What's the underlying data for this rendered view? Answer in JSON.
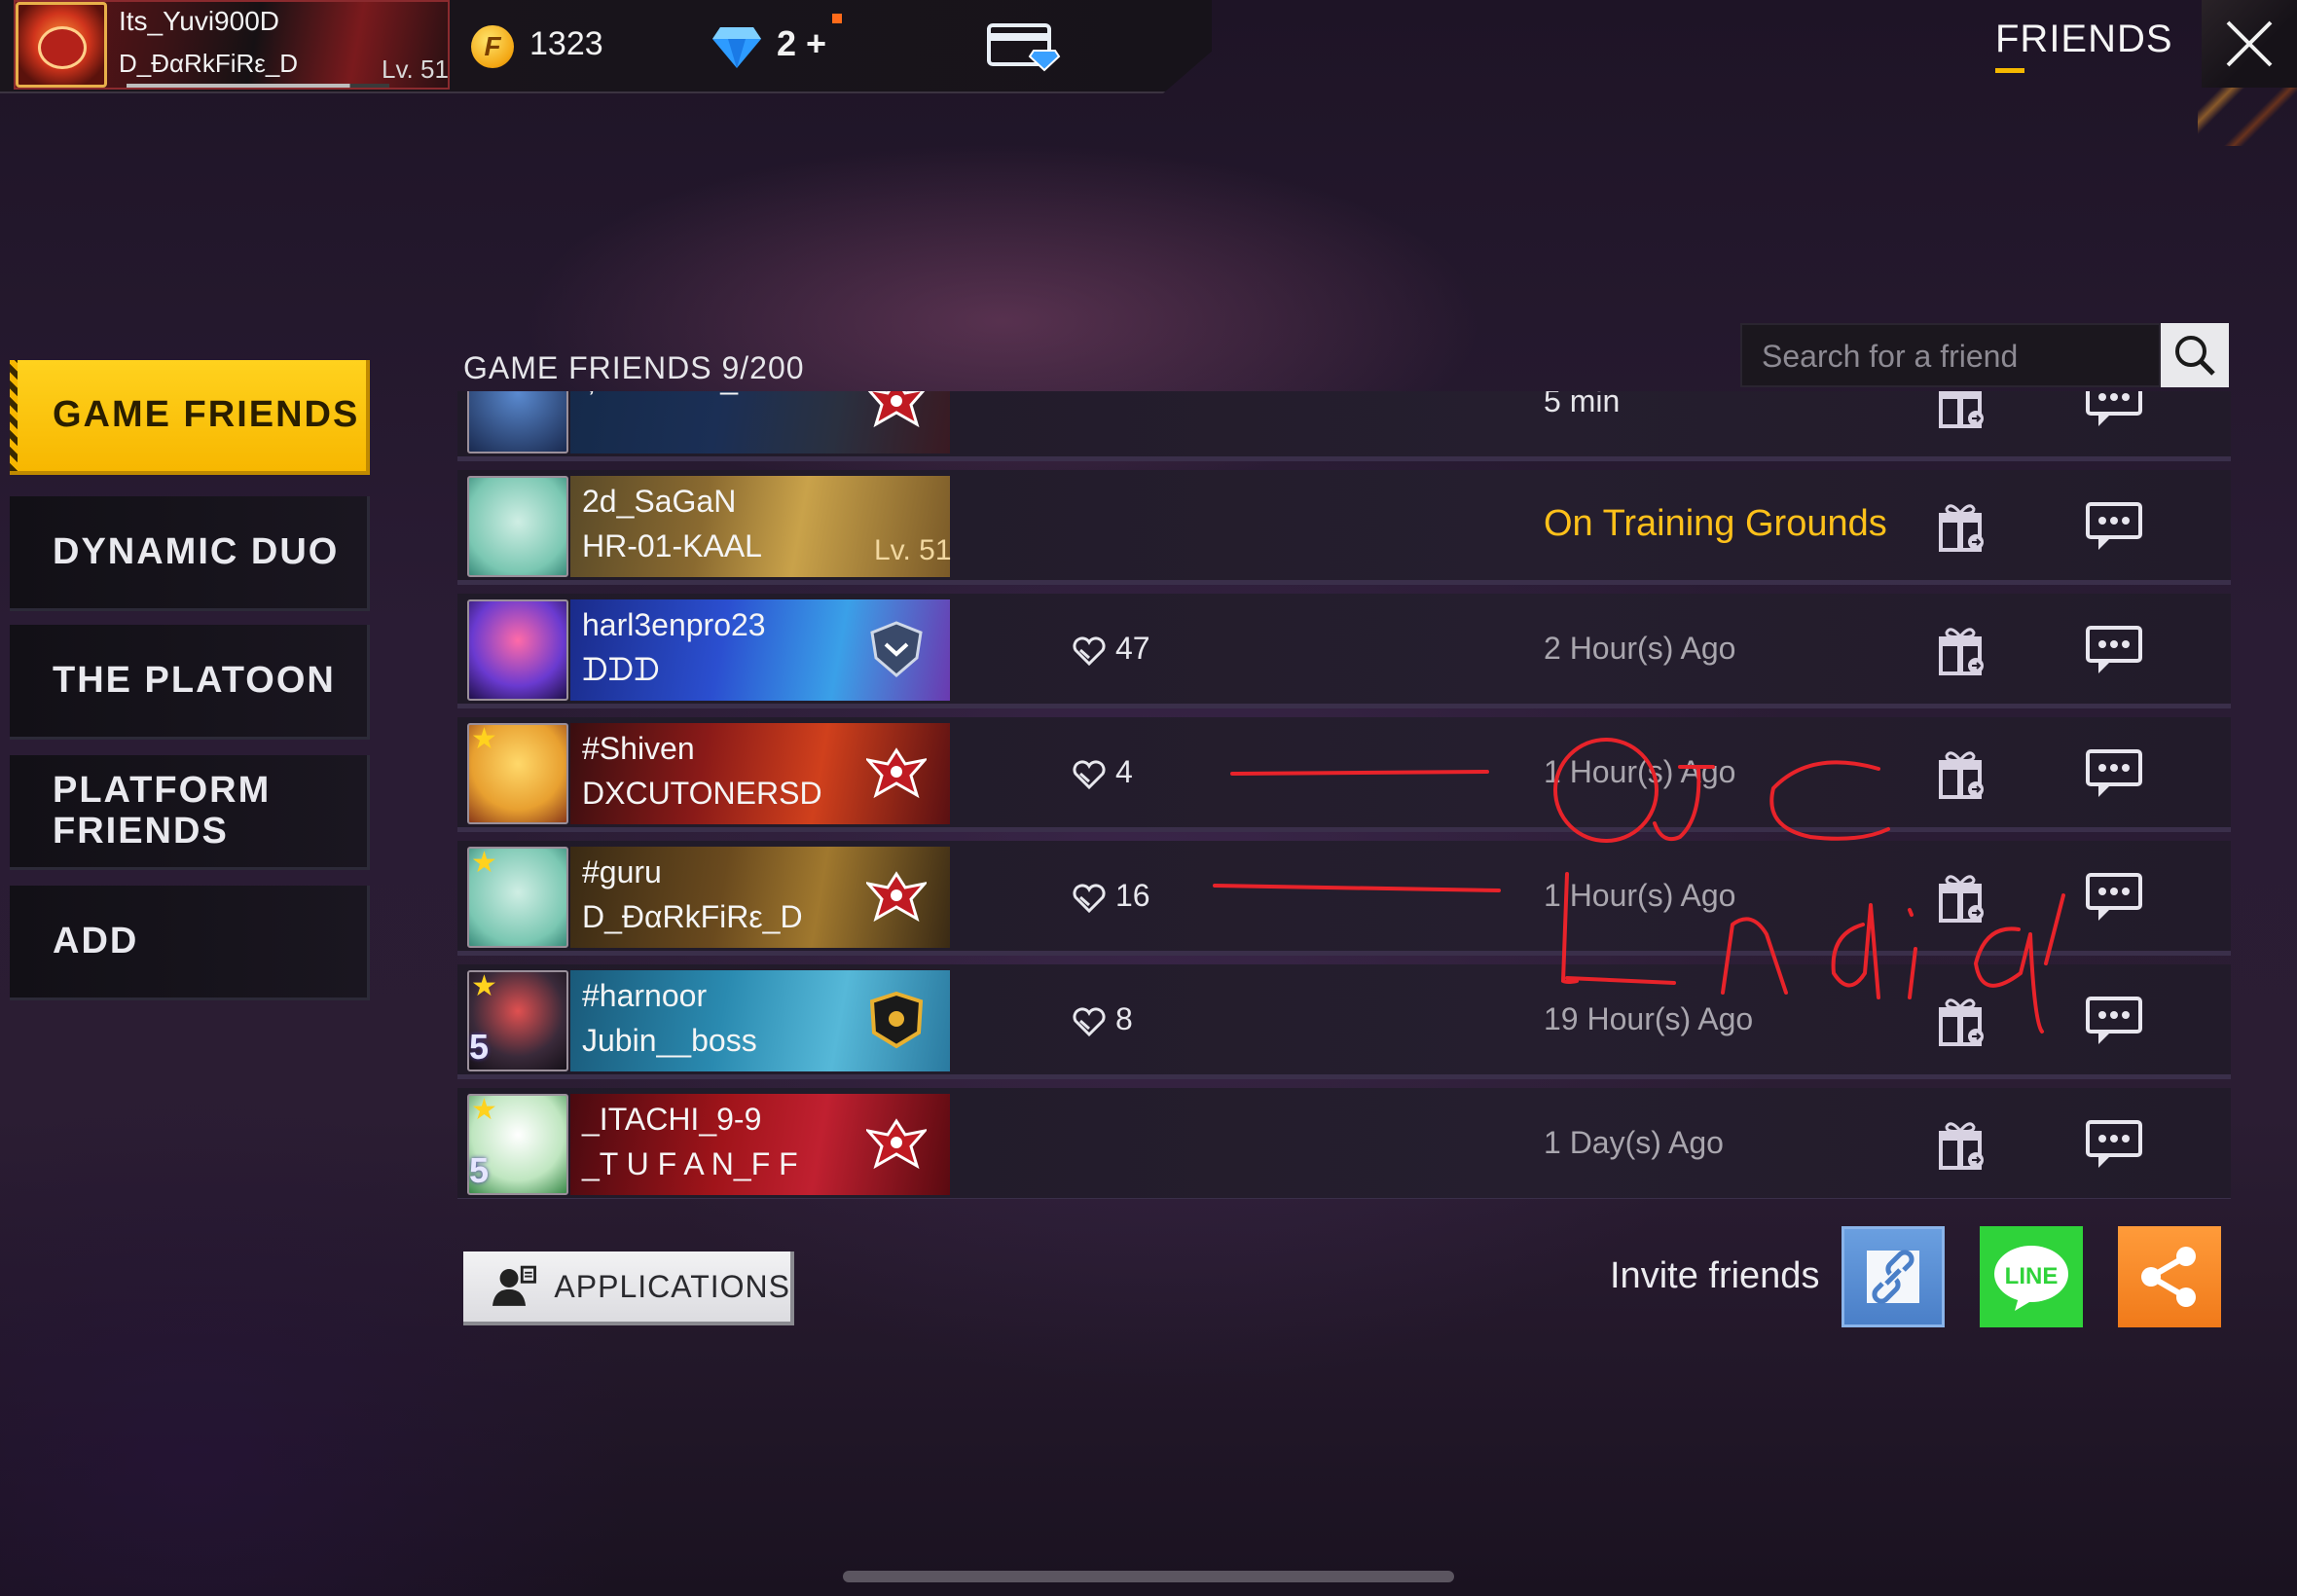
{
  "header": {
    "username": "Its_Yuvi900D",
    "guild": "D_ĐαRkFiRε_D",
    "level": "Lv. 51",
    "level_progress": 0.85,
    "coins": "1323",
    "diamonds": "2",
    "diamonds_plus": "+",
    "title": "FRIENDS"
  },
  "menu": [
    {
      "label": "GAME FRIENDS",
      "active": true
    },
    {
      "label": "DYNAMIC DUO",
      "active": false
    },
    {
      "label": "THE PLATOON",
      "active": false
    },
    {
      "label": "PLATFORM\nFRIENDS",
      "active": false
    },
    {
      "label": "ADD",
      "active": false
    }
  ],
  "list": {
    "header": "GAME FRIENDS 9/200",
    "search_placeholder": "Search for a friend"
  },
  "friends": [
    {
      "name": "ĻEGENĐ-_-FF",
      "guild": "",
      "level": "",
      "likes": "",
      "status": "5 min",
      "status_kind": "recent"
    },
    {
      "name": "2d_SaGaN",
      "guild": "HR-01-KAAL",
      "level": "Lv. 51",
      "likes": "",
      "status": "On Training Grounds",
      "status_kind": "active"
    },
    {
      "name": "harl3enpro23",
      "guild": "ᗪᗪᗪ",
      "level": "",
      "likes": "47",
      "status": "2 Hour(s) Ago",
      "status_kind": "offline"
    },
    {
      "name": "#Shiven",
      "guild": "DXCUTONERSD",
      "level": "",
      "likes": "4",
      "status": "1 Hour(s) Ago",
      "status_kind": "offline"
    },
    {
      "name": "#guru",
      "guild": "D_ĐαRkFiRε_D",
      "level": "",
      "likes": "16",
      "status": "1 Hour(s) Ago",
      "status_kind": "offline"
    },
    {
      "name": "#harnoor",
      "guild": "Jubin__boss",
      "level": "",
      "likes": "8",
      "status": "19 Hour(s) Ago",
      "status_kind": "offline"
    },
    {
      "name": "_ITACHI_9-9",
      "guild": "_T U F A N_F F",
      "level": "",
      "likes": "",
      "status": "1 Day(s) Ago",
      "status_kind": "offline"
    }
  ],
  "rank_badges": [
    "",
    "",
    "",
    "",
    "",
    "5",
    "5"
  ],
  "bottom": {
    "applications_label": "APPLICATIONS",
    "invite_label": "Invite friends",
    "line_label": "LINE"
  },
  "colors": {
    "accent_yellow": "#f7b700",
    "status_active": "#ffc11a",
    "line_green": "#2fd33a",
    "share_orange": "#f07a1a",
    "link_blue": "#4a7fc8",
    "annotation_red": "#e8232a"
  }
}
